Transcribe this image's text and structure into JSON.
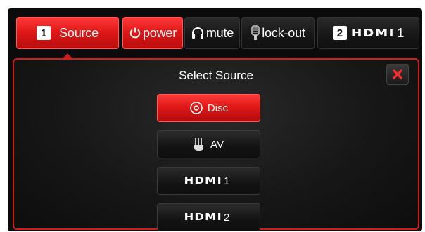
{
  "tabs": {
    "source": {
      "number": "1",
      "label": "Source"
    },
    "power": {
      "label": "power",
      "icon": "power-icon"
    },
    "mute": {
      "label": "mute",
      "icon": "headphones-icon"
    },
    "lockout": {
      "label": "lock-out",
      "icon": "lock-icon"
    },
    "hdmi": {
      "number": "2",
      "logo": "HDMI",
      "label": "1"
    }
  },
  "panel": {
    "title": "Select Source",
    "close_icon": "close-icon",
    "sources": [
      {
        "label": "Disc",
        "icon": "disc-icon",
        "active": true
      },
      {
        "label": "AV",
        "icon": "av-connector-icon",
        "active": false
      },
      {
        "logo": "HDMI",
        "label": "1",
        "active": false
      },
      {
        "logo": "HDMI",
        "label": "2",
        "active": false
      }
    ]
  },
  "colors": {
    "accent": "#e01818",
    "background": "#0b0b0b",
    "text": "#ffffff"
  }
}
